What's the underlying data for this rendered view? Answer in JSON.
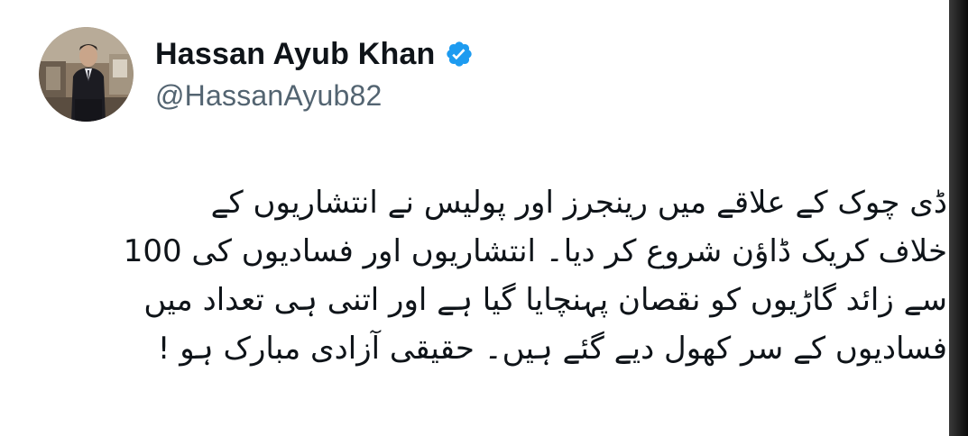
{
  "author": {
    "display_name": "Hassan Ayub Khan",
    "handle": "@HassanAyub82",
    "verified_icon": "verified-badge-icon",
    "avatar_icon": "profile-photo"
  },
  "tweet": {
    "lines": [
      "ڈی چوک کے علاقے میں رینجرز اور پولیس نے انتشاریوں کے",
      "خلاف کریک ڈاؤن شروع کر دیا۔ انتشاریوں اور فسادیوں کی 100",
      "سے زائد گاڑیوں کو نقصان پہنچایا گیا ہے اور اتنی ہی تعداد میں",
      "فسادیوں کے سر کھول دیے گئے ہیں۔ حقیقی آزادی مبارک ہو !"
    ]
  },
  "colors": {
    "background": "#ffffff",
    "text_primary": "#0f1419",
    "text_secondary": "#536471",
    "verified_blue": "#1d9bf0"
  }
}
